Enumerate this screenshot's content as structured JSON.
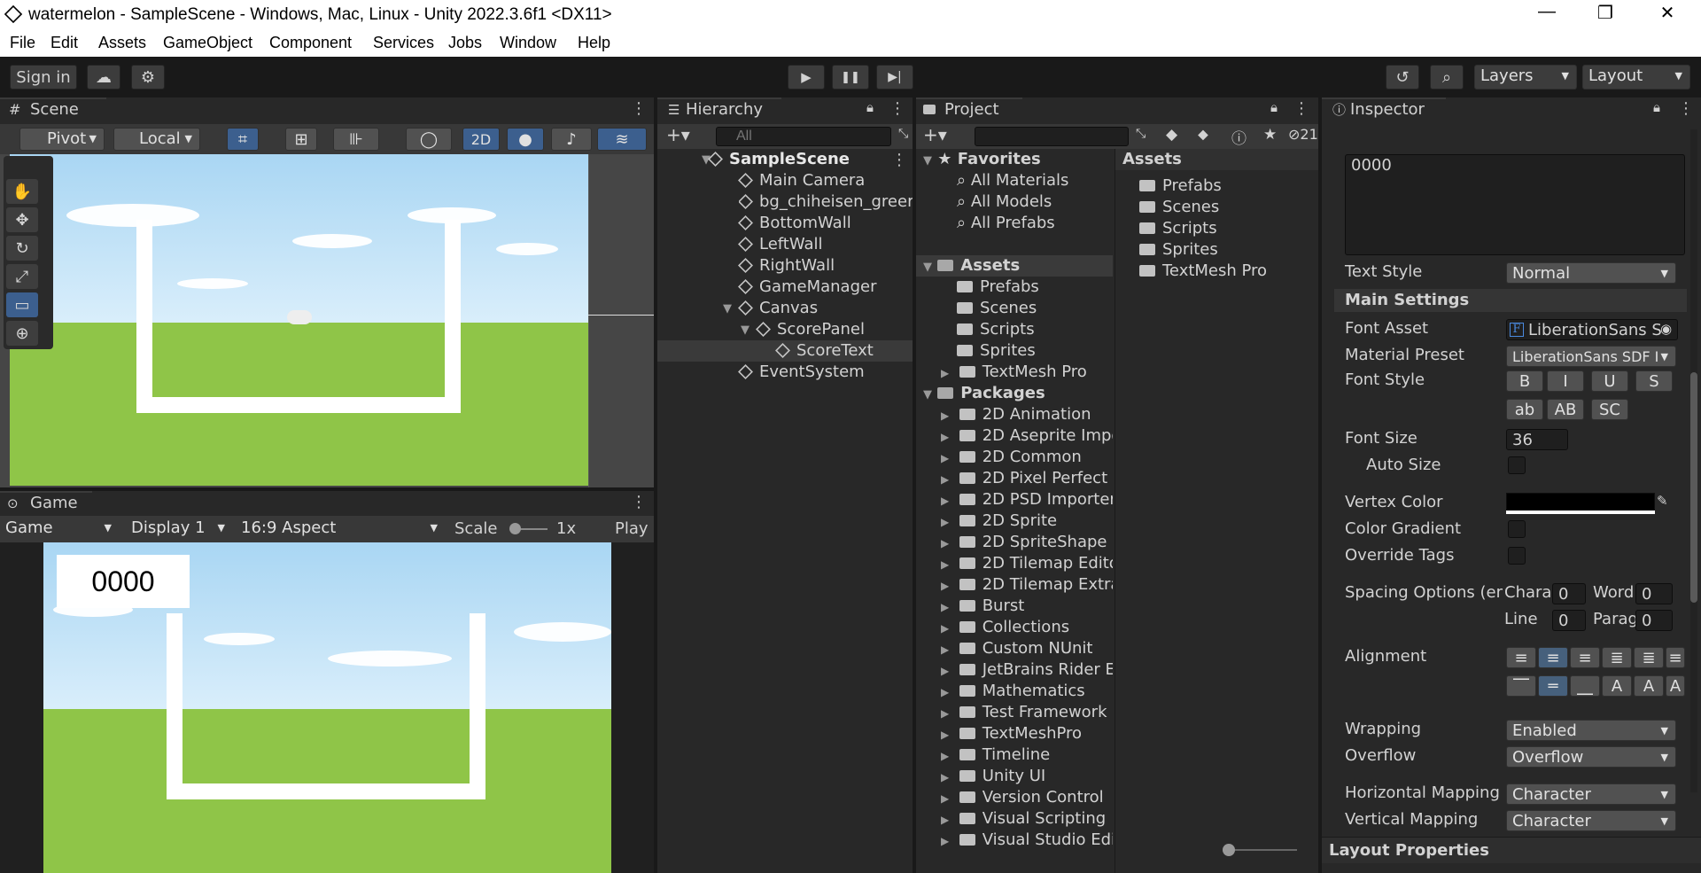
{
  "window": {
    "title": "watermelon - SampleScene - Windows, Mac, Linux - Unity 2022.3.6f1 <DX11>",
    "min": "—",
    "max": "❐",
    "close": "✕"
  },
  "menu": [
    "File",
    "Edit",
    "Assets",
    "GameObject",
    "Component",
    "Services",
    "Jobs",
    "Window",
    "Help"
  ],
  "toolbar": {
    "sign_in": "Sign in",
    "layers": "Layers",
    "layout": "Layout",
    "play": "▶",
    "pause": "❚❚",
    "step": "▶|"
  },
  "scene": {
    "tab": "Scene",
    "pivot": "Pivot",
    "local": "Local",
    "mode_2d": "2D"
  },
  "game": {
    "tab": "Game",
    "mode": "Game",
    "display": "Display 1",
    "aspect": "16:9 Aspect",
    "scale_label": "Scale",
    "scale_value": "1x",
    "play": "Play",
    "score": "0000"
  },
  "hierarchy": {
    "tab": "Hierarchy",
    "search_placeholder": "All",
    "scene": "SampleScene",
    "items": [
      "Main Camera",
      "bg_chiheisen_greer",
      "BottomWall",
      "LeftWall",
      "RightWall",
      "GameManager",
      "Canvas",
      "ScorePanel",
      "ScoreText",
      "EventSystem"
    ]
  },
  "project": {
    "tab": "Project",
    "hidden_count": "21",
    "favorites": "Favorites",
    "fav_items": [
      "All Materials",
      "All Models",
      "All Prefabs"
    ],
    "assets": "Assets",
    "asset_folders": [
      "Prefabs",
      "Scenes",
      "Scripts",
      "Sprites",
      "TextMesh Pro"
    ],
    "packages": "Packages",
    "package_folders": [
      "2D Animation",
      "2D Aseprite Impor",
      "2D Common",
      "2D Pixel Perfect",
      "2D PSD Importer",
      "2D Sprite",
      "2D SpriteShape",
      "2D Tilemap Edito",
      "2D Tilemap Extra",
      "Burst",
      "Collections",
      "Custom NUnit",
      "JetBrains Rider E",
      "Mathematics",
      "Test Framework",
      "TextMeshPro",
      "Timeline",
      "Unity UI",
      "Version Control",
      "Visual Scripting",
      "Visual Studio Edit"
    ],
    "right_header": "Assets",
    "right_items": [
      "Prefabs",
      "Scenes",
      "Scripts",
      "Sprites",
      "TextMesh Pro"
    ]
  },
  "inspector": {
    "tab": "Inspector",
    "text_value": "0000",
    "text_style_label": "Text Style",
    "text_style": "Normal",
    "main_settings": "Main Settings",
    "font_asset_label": "Font Asset",
    "font_asset": "LiberationSans S",
    "material_preset_label": "Material Preset",
    "material_preset": "LiberationSans SDF I",
    "font_style_label": "Font Style",
    "styles_row1": [
      "B",
      "I",
      "U",
      "S"
    ],
    "styles_row2": [
      "ab",
      "AB",
      "SC"
    ],
    "font_size_label": "Font Size",
    "font_size": "36",
    "auto_size_label": "Auto Size",
    "vertex_color_label": "Vertex Color",
    "vertex_color": "#000000",
    "color_gradient_label": "Color Gradient",
    "override_tags_label": "Override Tags",
    "spacing_label": "Spacing Options (em",
    "spacing": {
      "chara_label": "Chara",
      "chara": "0",
      "word_label": "Word",
      "word": "0",
      "line_label": "Line",
      "line": "0",
      "parag_label": "Parag",
      "parag": "0"
    },
    "alignment_label": "Alignment",
    "wrapping_label": "Wrapping",
    "wrapping": "Enabled",
    "overflow_label": "Overflow",
    "overflow": "Overflow",
    "hmap_label": "Horizontal Mapping",
    "hmap": "Character",
    "vmap_label": "Vertical Mapping",
    "vmap": "Character",
    "layout_properties": "Layout Properties"
  }
}
